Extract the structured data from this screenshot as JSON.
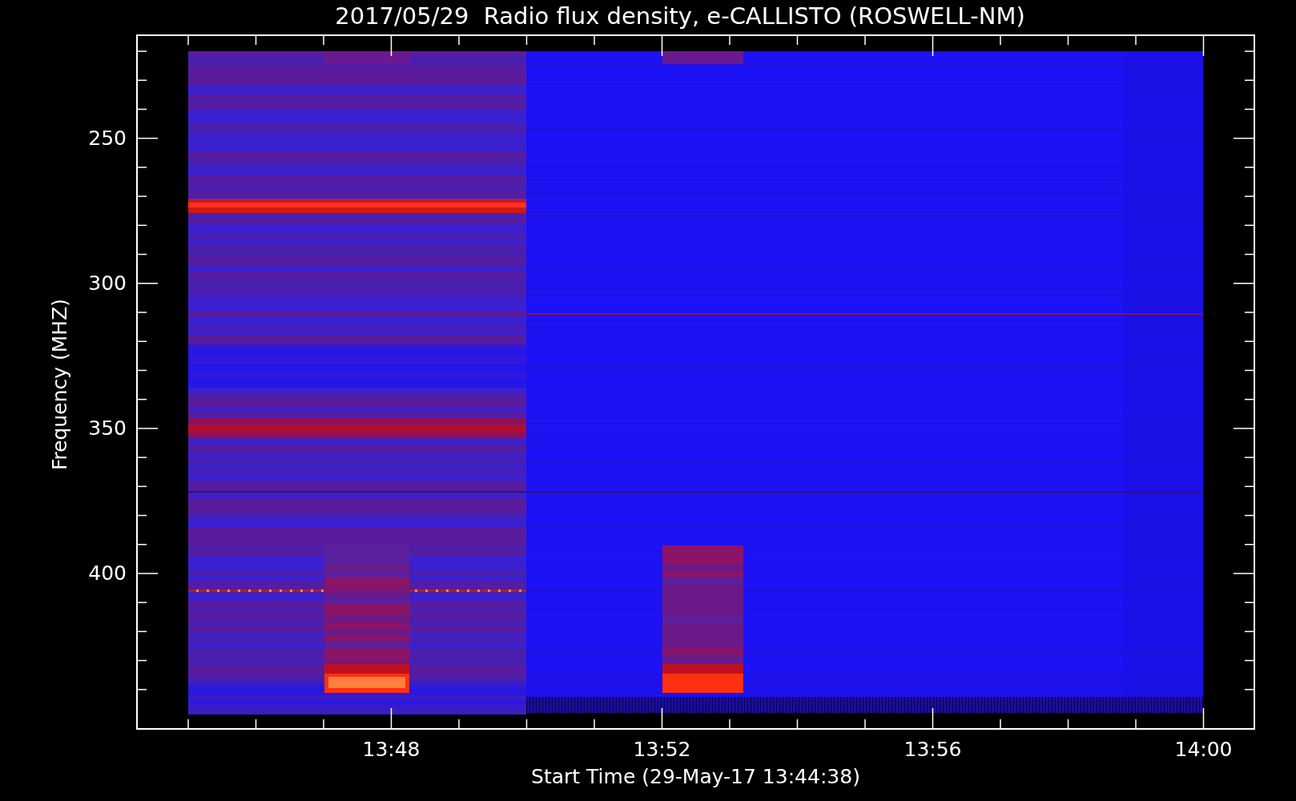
{
  "title": "2017/05/29  Radio flux density, e-CALLISTO (ROSWELL-NM)",
  "y_axis": {
    "label": "Frequency (MHZ)",
    "ticks": [
      "250",
      "300",
      "350",
      "400"
    ]
  },
  "x_axis": {
    "label": "Start Time (29-May-17 13:44:38)",
    "ticks": [
      "13:48",
      "13:52",
      "13:56",
      "14:00"
    ]
  }
}
